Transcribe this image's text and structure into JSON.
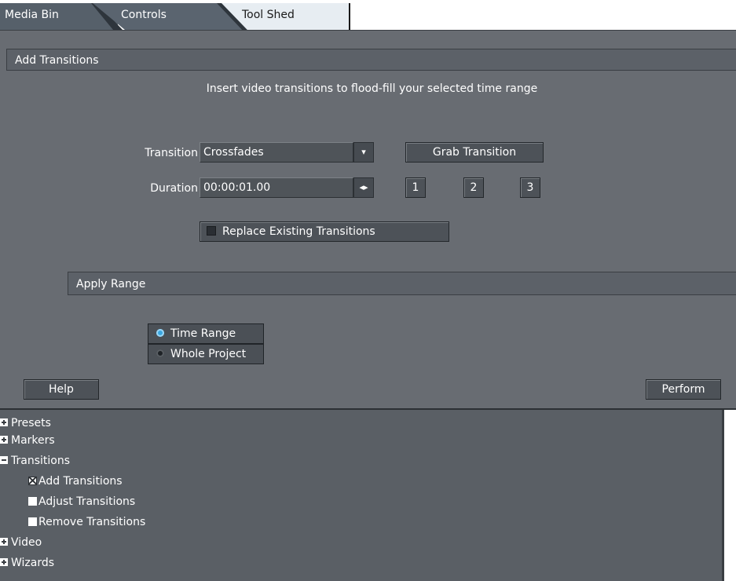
{
  "tabs": [
    "Media Bin",
    "Controls",
    "Tool Shed"
  ],
  "section_title": "Add Transitions",
  "instruction": "Insert video transitions to flood-fill your selected time range",
  "transition": {
    "label": "Transition",
    "value": "Crossfades",
    "dropdown_glyph": "▾"
  },
  "grab_transition": "Grab Transition",
  "duration": {
    "label": "Duration",
    "value": "00:00:01.00",
    "spin_glyph": "◂▸"
  },
  "presets": [
    "1",
    "2",
    "3"
  ],
  "replace_existing": "Replace Existing Transitions",
  "apply_range": {
    "title": "Apply Range",
    "options": [
      {
        "label": "Time Range",
        "selected": true
      },
      {
        "label": "Whole Project",
        "selected": false
      }
    ]
  },
  "footer": {
    "help": "Help",
    "perform": "Perform"
  },
  "tree": [
    {
      "label": "Presets",
      "type": "group",
      "state": "collapsed"
    },
    {
      "label": "Markers",
      "type": "group",
      "state": "collapsed"
    },
    {
      "label": "Transitions",
      "type": "group",
      "state": "expanded"
    },
    {
      "label": "Add Transitions",
      "type": "leaf",
      "checked": true
    },
    {
      "label": "Adjust Transitions",
      "type": "leaf",
      "checked": false
    },
    {
      "label": "Remove Transitions",
      "type": "leaf",
      "checked": false
    },
    {
      "label": "Video",
      "type": "group",
      "state": "collapsed"
    },
    {
      "label": "Wizards",
      "type": "group",
      "state": "collapsed"
    }
  ]
}
